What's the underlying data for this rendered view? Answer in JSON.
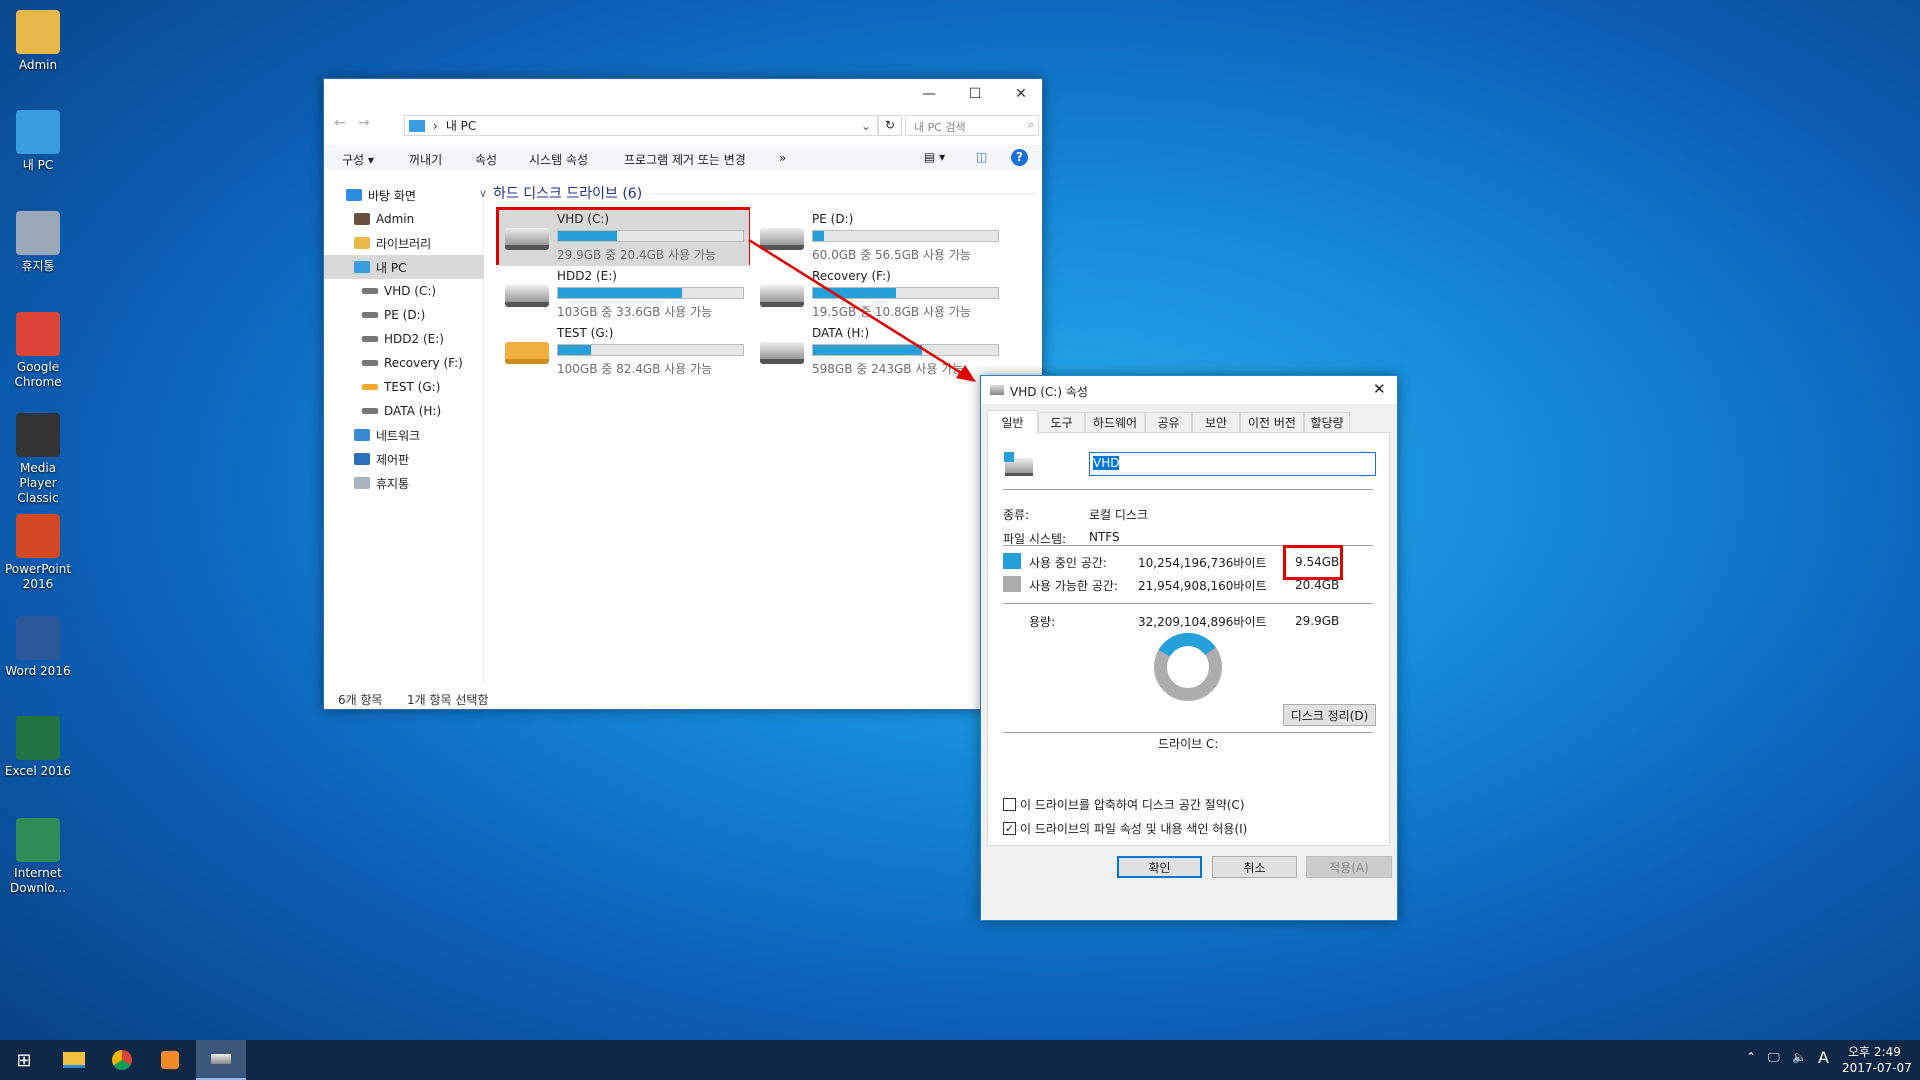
{
  "desktop": {
    "icons": [
      {
        "label": "Admin",
        "icon": "user-folder-icon",
        "color": "#e8b84a"
      },
      {
        "label": "내 PC",
        "icon": "computer-icon",
        "color": "#3a9be0"
      },
      {
        "label": "휴지통",
        "icon": "recycle-bin-icon",
        "color": "#9aa8b8"
      },
      {
        "label": "Google Chrome",
        "icon": "chrome-icon",
        "color": "#db4437"
      },
      {
        "label": "Media Player Classic",
        "icon": "media-player-icon",
        "color": "#333333"
      },
      {
        "label": "PowerPoint 2016",
        "icon": "powerpoint-icon",
        "color": "#d24726"
      },
      {
        "label": "Word 2016",
        "icon": "word-icon",
        "color": "#2b579a"
      },
      {
        "label": "Excel 2016",
        "icon": "excel-icon",
        "color": "#217346"
      },
      {
        "label": "Internet Downlo...",
        "icon": "idm-icon",
        "color": "#2e8b57"
      }
    ]
  },
  "explorer": {
    "address": "내 PC",
    "search_placeholder": "내 PC 검색",
    "toolbar": [
      "구성 ▾",
      "꺼내기",
      "속성",
      "시스템 속성",
      "프로그램 제거 또는 변경",
      "»"
    ],
    "nav": [
      {
        "label": "바탕 화면",
        "level": 0,
        "icon": "desktop-icon"
      },
      {
        "label": "Admin",
        "level": 1,
        "icon": "user-icon"
      },
      {
        "label": "라이브러리",
        "level": 1,
        "icon": "library-icon"
      },
      {
        "label": "내 PC",
        "level": 1,
        "icon": "computer-icon",
        "selected": true
      },
      {
        "label": "VHD (C:)",
        "level": 2,
        "icon": "drive-icon"
      },
      {
        "label": "PE (D:)",
        "level": 2,
        "icon": "drive-icon"
      },
      {
        "label": "HDD2 (E:)",
        "level": 2,
        "icon": "drive-icon"
      },
      {
        "label": "Recovery (F:)",
        "level": 2,
        "icon": "drive-icon"
      },
      {
        "label": "TEST (G:)",
        "level": 2,
        "icon": "usb-drive-icon"
      },
      {
        "label": "DATA (H:)",
        "level": 2,
        "icon": "drive-icon"
      },
      {
        "label": "네트워크",
        "level": 1,
        "icon": "network-icon"
      },
      {
        "label": "제어판",
        "level": 1,
        "icon": "control-panel-icon"
      },
      {
        "label": "휴지통",
        "level": 1,
        "icon": "recycle-bin-icon"
      }
    ],
    "group_header": "하드 디스크 드라이브 (6)",
    "drives": [
      {
        "name": "VHD (C:)",
        "info": "29.9GB 중 20.4GB 사용 가능",
        "used_fraction": 0.32,
        "selected": true
      },
      {
        "name": "PE (D:)",
        "info": "60.0GB 중 56.5GB 사용 가능",
        "used_fraction": 0.06
      },
      {
        "name": "HDD2 (E:)",
        "info": "103GB 중 33.6GB 사용 가능",
        "used_fraction": 0.67
      },
      {
        "name": "Recovery (F:)",
        "info": "19.5GB 중 10.8GB 사용 가능",
        "used_fraction": 0.45
      },
      {
        "name": "TEST (G:)",
        "info": "100GB 중 82.4GB 사용 가능",
        "used_fraction": 0.18
      },
      {
        "name": "DATA (H:)",
        "info": "598GB 중 243GB 사용 가능",
        "used_fraction": 0.59
      }
    ],
    "status_count": "6개 항목",
    "status_selected": "1개 항목 선택함"
  },
  "dialog": {
    "title": "VHD (C:) 속성",
    "tabs": [
      "일반",
      "도구",
      "하드웨어",
      "공유",
      "보안",
      "이전 버전",
      "할당량"
    ],
    "name_value": "VHD",
    "type_label": "종류:",
    "type_value": "로컬 디스크",
    "fs_label": "파일 시스템:",
    "fs_value": "NTFS",
    "used_label": "사용 중인 공간:",
    "used_bytes": "10,254,196,736바이트",
    "used_gb": "9.54GB",
    "free_label": "사용 가능한 공간:",
    "free_bytes": "21,954,908,160바이트",
    "free_gb": "20.4GB",
    "cap_label": "용량:",
    "cap_bytes": "32,209,104,896바이트",
    "cap_gb": "29.9GB",
    "used_fraction": 0.318,
    "used_color": "#26a0da",
    "free_color": "#adadad",
    "drive_label": "드라이브 C:",
    "cleanup": "디스크 정리(D)",
    "compress": "이 드라이브를 압축하여 디스크 공간 절약(C)",
    "compress_checked": false,
    "index": "이 드라이브의 파일 속성 및 내용 색인 허용(I)",
    "index_checked": true,
    "ok": "확인",
    "cancel": "취소",
    "apply": "적용(A)"
  },
  "taskbar": {
    "time": "오후 2:49",
    "date": "2017-07-07",
    "ime": "A"
  },
  "annotation_color": "#e00000"
}
